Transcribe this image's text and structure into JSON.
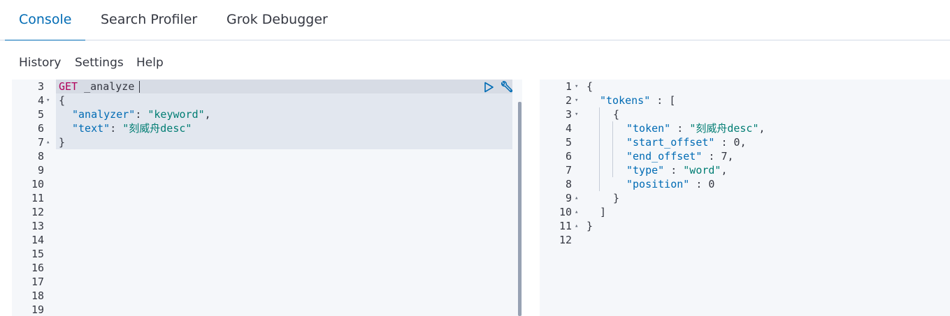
{
  "tabs": [
    {
      "label": "Console",
      "active": true
    },
    {
      "label": "Search Profiler",
      "active": false
    },
    {
      "label": "Grok Debugger",
      "active": false
    }
  ],
  "menu": {
    "history": "History",
    "settings": "Settings",
    "help": "Help"
  },
  "request": {
    "line_numbers": [
      "3",
      "4",
      "5",
      "6",
      "7",
      "8",
      "9",
      "10",
      "11",
      "12",
      "13",
      "14",
      "15",
      "16",
      "17",
      "18",
      "19"
    ],
    "method": "GET",
    "path": "_analyze",
    "open_brace": "{",
    "analyzer_key": "\"analyzer\"",
    "analyzer_sep": ": ",
    "analyzer_value": "\"keyword\"",
    "analyzer_comma": ",",
    "text_key": "\"text\"",
    "text_sep": ": ",
    "text_value": "\"刻威舟desc\"",
    "close_brace": "}",
    "icons": {
      "run": "play-icon",
      "wrench": "wrench-icon"
    }
  },
  "response": {
    "line_numbers": [
      "1",
      "2",
      "3",
      "4",
      "5",
      "6",
      "7",
      "8",
      "9",
      "10",
      "11",
      "12"
    ],
    "l1": "{",
    "l2_key": "\"tokens\"",
    "l2_rest": " : [",
    "l3": "{",
    "l4_key": "\"token\"",
    "l4_sep": " : ",
    "l4_val": "\"刻威舟desc\"",
    "l4_end": ",",
    "l5_key": "\"start_offset\"",
    "l5_sep": " : ",
    "l5_val": "0",
    "l5_end": ",",
    "l6_key": "\"end_offset\"",
    "l6_sep": " : ",
    "l6_val": "7",
    "l6_end": ",",
    "l7_key": "\"type\"",
    "l7_sep": " : ",
    "l7_val": "\"word\"",
    "l7_end": ",",
    "l8_key": "\"position\"",
    "l8_sep": " : ",
    "l8_val": "0",
    "l9": "}",
    "l10": "]",
    "l11": "}"
  },
  "colors": {
    "accent": "#006bb4",
    "method": "#b0005a",
    "string": "#017d73",
    "editor_bg": "#f5f7fa"
  }
}
